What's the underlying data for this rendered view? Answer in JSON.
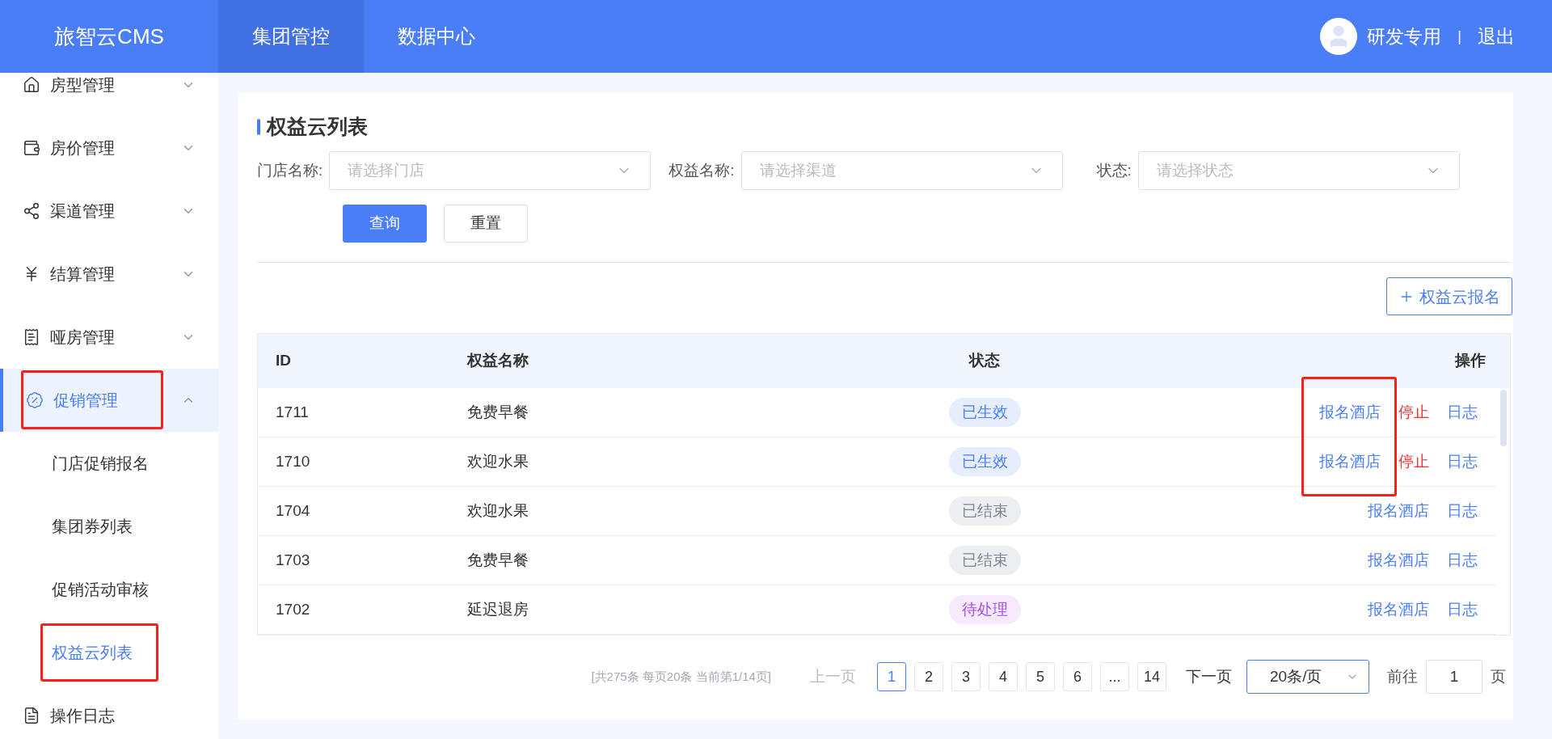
{
  "header": {
    "logo": "旅智云CMS",
    "nav": [
      {
        "label": "集团管控",
        "selected": true
      },
      {
        "label": "数据中心",
        "selected": false
      }
    ],
    "user": "研发专用",
    "separator": "|",
    "logout": "退出"
  },
  "sidebar": {
    "items": [
      {
        "label": "房型管理",
        "expanded": false,
        "selected": false,
        "highlighted": false
      },
      {
        "label": "房价管理",
        "expanded": false,
        "selected": false,
        "highlighted": false
      },
      {
        "label": "渠道管理",
        "expanded": false,
        "selected": false,
        "highlighted": false
      },
      {
        "label": "结算管理",
        "expanded": false,
        "selected": false,
        "highlighted": false
      },
      {
        "label": "哑房管理",
        "expanded": false,
        "selected": false,
        "highlighted": false
      },
      {
        "label": "促销管理",
        "expanded": true,
        "selected": true,
        "highlighted": true,
        "children": [
          {
            "label": "门店促销报名",
            "selected": false,
            "highlighted": false
          },
          {
            "label": "集团券列表",
            "selected": false,
            "highlighted": false
          },
          {
            "label": "促销活动审核",
            "selected": false,
            "highlighted": false
          },
          {
            "label": "权益云列表",
            "selected": true,
            "highlighted": true
          }
        ]
      },
      {
        "label": "操作日志",
        "selected": false,
        "highlighted": false
      }
    ]
  },
  "page": {
    "title": "权益云列表",
    "filters": [
      {
        "label": "门店名称:",
        "placeholder": "请选择门店"
      },
      {
        "label": "权益名称:",
        "placeholder": "请选择渠道"
      },
      {
        "label": "状态:",
        "placeholder": "请选择状态"
      }
    ],
    "query_button": "查询",
    "reset_button": "重置",
    "add_button": "权益云报名",
    "table": {
      "columns": [
        "ID",
        "权益名称",
        "状态",
        "操作"
      ],
      "rows": [
        {
          "id": "1711",
          "name": "免费早餐",
          "status": {
            "text": "已生效",
            "kind": "active"
          },
          "highlighted": true,
          "actions": [
            {
              "text": "报名酒店",
              "kind": "link"
            },
            {
              "text": "停止",
              "kind": "danger"
            },
            {
              "text": "日志",
              "kind": "link"
            }
          ]
        },
        {
          "id": "1710",
          "name": "欢迎水果",
          "status": {
            "text": "已生效",
            "kind": "active"
          },
          "highlighted": true,
          "actions": [
            {
              "text": "报名酒店",
              "kind": "link"
            },
            {
              "text": "停止",
              "kind": "danger"
            },
            {
              "text": "日志",
              "kind": "link"
            }
          ]
        },
        {
          "id": "1704",
          "name": "欢迎水果",
          "status": {
            "text": "已结束",
            "kind": "ended"
          },
          "highlighted": false,
          "actions": [
            {
              "text": "报名酒店",
              "kind": "link"
            },
            {
              "text": "日志",
              "kind": "link"
            }
          ]
        },
        {
          "id": "1703",
          "name": "免费早餐",
          "status": {
            "text": "已结束",
            "kind": "ended"
          },
          "highlighted": false,
          "actions": [
            {
              "text": "报名酒店",
              "kind": "link"
            },
            {
              "text": "日志",
              "kind": "link"
            }
          ]
        },
        {
          "id": "1702",
          "name": "延迟退房",
          "status": {
            "text": "待处理",
            "kind": "pending"
          },
          "highlighted": false,
          "actions": [
            {
              "text": "报名酒店",
              "kind": "link"
            },
            {
              "text": "日志",
              "kind": "link"
            }
          ]
        }
      ]
    },
    "pagination": {
      "summary": "[共275条 每页20条 当前第1/14页]",
      "prev": {
        "text": "上一页",
        "disabled": true
      },
      "pages": [
        {
          "text": "1",
          "selected": true
        },
        {
          "text": "2",
          "selected": false
        },
        {
          "text": "3",
          "selected": false
        },
        {
          "text": "4",
          "selected": false
        },
        {
          "text": "5",
          "selected": false
        },
        {
          "text": "6",
          "selected": false
        },
        {
          "text": "...",
          "selected": false
        },
        {
          "text": "14",
          "selected": false
        }
      ],
      "next": {
        "text": "下一页",
        "disabled": false
      },
      "page_size": "20条/页",
      "goto_label": "前往",
      "goto_value": "1",
      "goto_suffix": "页"
    }
  }
}
